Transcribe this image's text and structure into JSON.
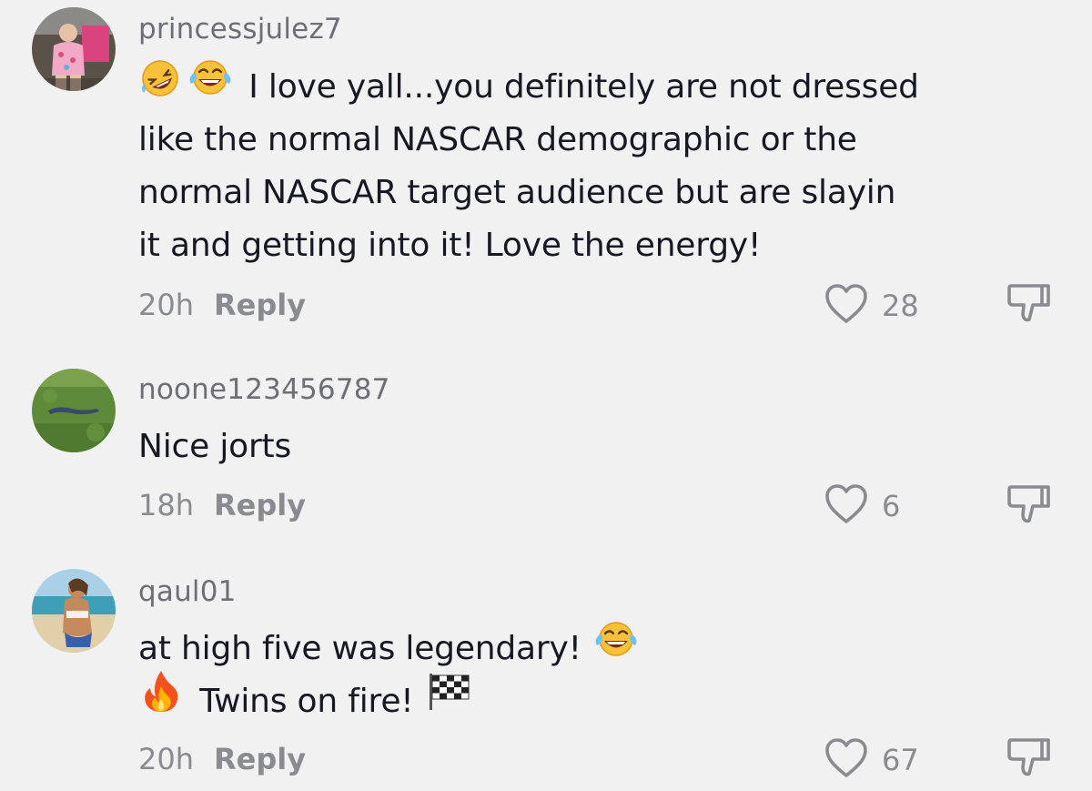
{
  "comments": [
    {
      "username": "princessjulez7",
      "emoji_prefix": [
        "rolling-on-floor-laughing-emoji",
        "face-with-tears-of-joy-emoji"
      ],
      "lines": [
        "I love yall...you definitely are not dressed",
        "like the normal NASCAR demographic or the",
        "normal NASCAR target audience but are slayin",
        "it and getting into it! Love the energy!"
      ],
      "time": "20h",
      "reply_label": "Reply",
      "likes": "28"
    },
    {
      "username": "noone123456787",
      "lines": [
        "Nice jorts"
      ],
      "time": "18h",
      "reply_label": "Reply",
      "likes": "6"
    },
    {
      "username": "qaul01",
      "lines": [
        "at high five was legendary!",
        "Twins on fire!"
      ],
      "time": "20h",
      "reply_label": "Reply",
      "likes": "67"
    }
  ],
  "colors": {
    "background": "#f1f1f2",
    "username": "#6d6e76",
    "text": "#161823",
    "meta": "#8a8b91"
  }
}
